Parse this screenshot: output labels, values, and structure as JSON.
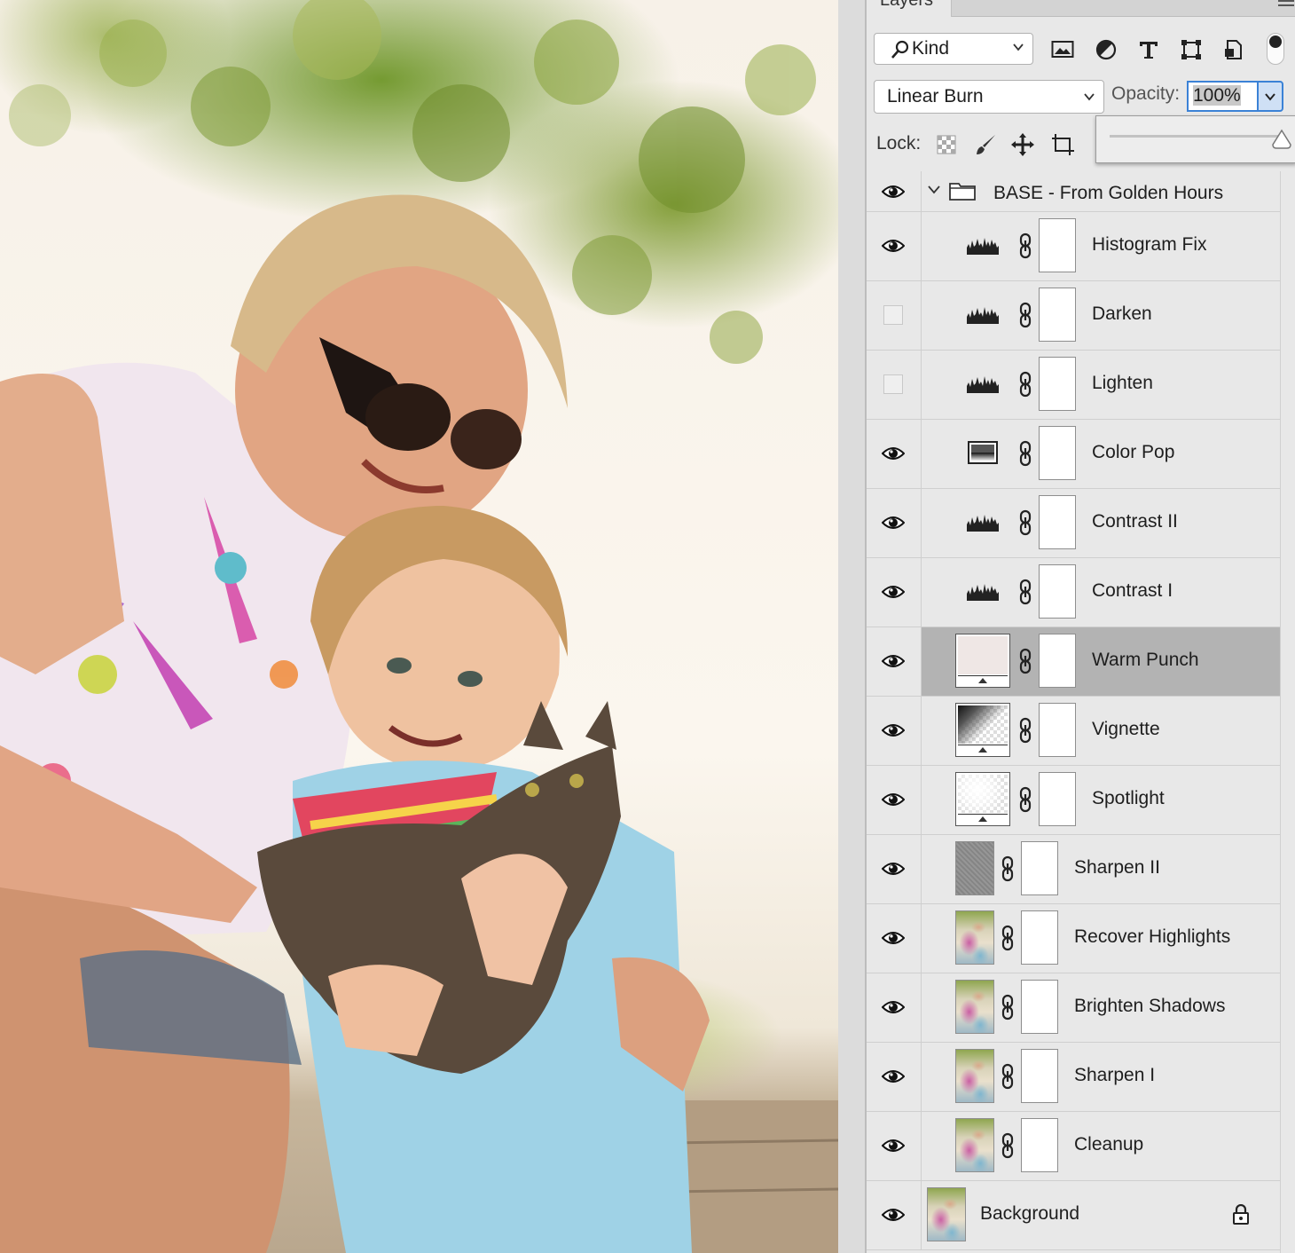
{
  "panel": {
    "tab_label": "Layers",
    "filter": {
      "kind_label": "Kind",
      "icons": [
        "image-filter-icon",
        "adjustment-filter-icon",
        "type-filter-icon",
        "shape-filter-icon",
        "smart-object-filter-icon"
      ]
    },
    "blend_mode": "Linear Burn",
    "opacity_label": "Opacity:",
    "opacity_value": "100%",
    "opacity_slider_value": 1.0,
    "lock_label": "Lock:",
    "accent_color": "#3b82d6",
    "selected_row_color": "#b3b3b3"
  },
  "layers": {
    "group_name": "BASE - From Golden Hours",
    "items": [
      {
        "name": "Histogram Fix",
        "visible": true,
        "thumbnail": "levels-adjustment-icon"
      },
      {
        "name": "Darken",
        "visible": false,
        "thumbnail": "levels-adjustment-icon"
      },
      {
        "name": "Lighten",
        "visible": false,
        "thumbnail": "levels-adjustment-icon"
      },
      {
        "name": "Color Pop",
        "visible": true,
        "thumbnail": "gradient-map-adjustment-icon"
      },
      {
        "name": "Contrast II",
        "visible": true,
        "thumbnail": "levels-adjustment-icon"
      },
      {
        "name": "Contrast I",
        "visible": true,
        "thumbnail": "levels-adjustment-icon"
      },
      {
        "name": "Warm Punch",
        "visible": true,
        "thumbnail": "solid-fill-thumbnail",
        "selected": true
      },
      {
        "name": "Vignette",
        "visible": true,
        "thumbnail": "gradient-fill-thumbnail"
      },
      {
        "name": "Spotlight",
        "visible": true,
        "thumbnail": "gradient-fill-thumbnail"
      },
      {
        "name": "Sharpen II",
        "visible": true,
        "thumbnail": "gray-texture-thumbnail"
      },
      {
        "name": "Recover Highlights",
        "visible": true,
        "thumbnail": "photo-thumbnail"
      },
      {
        "name": "Brighten Shadows",
        "visible": true,
        "thumbnail": "photo-thumbnail"
      },
      {
        "name": "Sharpen I",
        "visible": true,
        "thumbnail": "photo-thumbnail"
      },
      {
        "name": "Cleanup",
        "visible": true,
        "thumbnail": "photo-thumbnail"
      }
    ],
    "background": {
      "name": "Background",
      "visible": true,
      "locked": true
    }
  }
}
